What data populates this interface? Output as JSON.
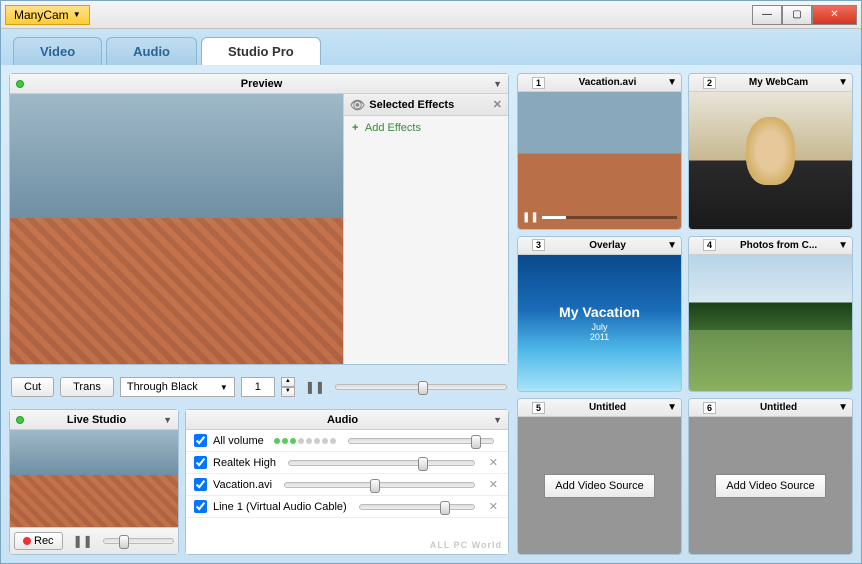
{
  "app": {
    "title": "ManyCam"
  },
  "tabs": [
    {
      "label": "Video",
      "active": false
    },
    {
      "label": "Audio",
      "active": false
    },
    {
      "label": "Studio Pro",
      "active": true
    }
  ],
  "preview": {
    "title": "Preview",
    "effects_title": "Selected Effects",
    "add_effects": "Add Effects",
    "cut_btn": "Cut",
    "trans_btn": "Trans",
    "transition_select": "Through Black",
    "duration": "1"
  },
  "live_studio": {
    "title": "Live Studio",
    "rec_btn": "Rec"
  },
  "audio": {
    "title": "Audio",
    "rows": [
      {
        "label": "All volume",
        "checked": true,
        "removable": false,
        "vol_indicator": true
      },
      {
        "label": "Realtek High",
        "checked": true,
        "removable": true
      },
      {
        "label": "Vacation.avi",
        "checked": true,
        "removable": true
      },
      {
        "label": "Line 1 (Virtual Audio Cable)",
        "checked": true,
        "removable": true
      }
    ]
  },
  "sources": [
    {
      "num": "1",
      "title": "Vacation.avi",
      "kind": "town",
      "playbar": true
    },
    {
      "num": "2",
      "title": "My WebCam",
      "kind": "webcam"
    },
    {
      "num": "3",
      "title": "Overlay",
      "kind": "overlay",
      "overlay": {
        "t1": "My Vacation",
        "t2": "July",
        "t3": "2011"
      }
    },
    {
      "num": "4",
      "title": "Photos from C...",
      "kind": "photos"
    },
    {
      "num": "5",
      "title": "Untitled",
      "kind": "empty"
    },
    {
      "num": "6",
      "title": "Untitled",
      "kind": "empty"
    }
  ],
  "add_source_btn": "Add Video Source",
  "watermark": "ALL PC World"
}
